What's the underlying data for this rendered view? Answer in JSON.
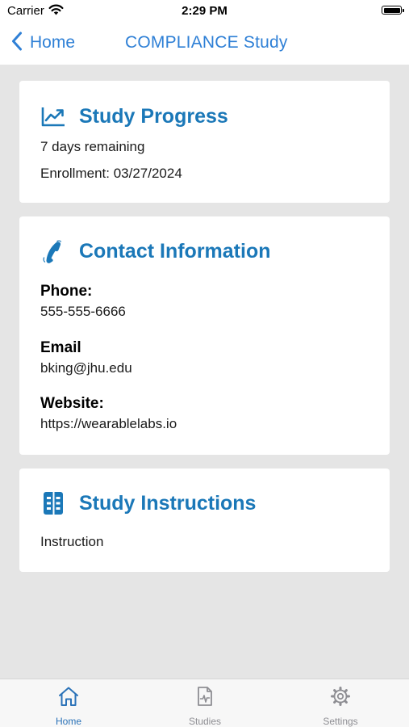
{
  "status_bar": {
    "carrier": "Carrier",
    "time": "2:29 PM"
  },
  "nav": {
    "back_label": "Home",
    "title": "COMPLIANCE Study",
    "accent_color": "#2f80d6"
  },
  "study_progress": {
    "title": "Study Progress",
    "icon": "trending-up-icon",
    "remaining": "7 days remaining",
    "enrollment": "Enrollment: 03/27/2024"
  },
  "contact": {
    "title": "Contact Information",
    "icon": "phone-icon",
    "phone_label": "Phone:",
    "phone_value": "555-555-6666",
    "email_label": "Email",
    "email_value": "bking@jhu.edu",
    "website_label": "Website:",
    "website_value": "https://wearablelabs.io"
  },
  "instructions": {
    "title": "Study Instructions",
    "icon": "document-list-icon",
    "text": "Instruction"
  },
  "tabs": [
    {
      "label": "Home",
      "icon": "home-icon",
      "active": true
    },
    {
      "label": "Studies",
      "icon": "studies-document-icon",
      "active": false
    },
    {
      "label": "Settings",
      "icon": "gear-icon",
      "active": false
    }
  ],
  "colors": {
    "card_title": "#1b78b8",
    "background": "#e5e5e5",
    "tab_active": "#2a72b8",
    "tab_inactive": "#8e8e93"
  }
}
